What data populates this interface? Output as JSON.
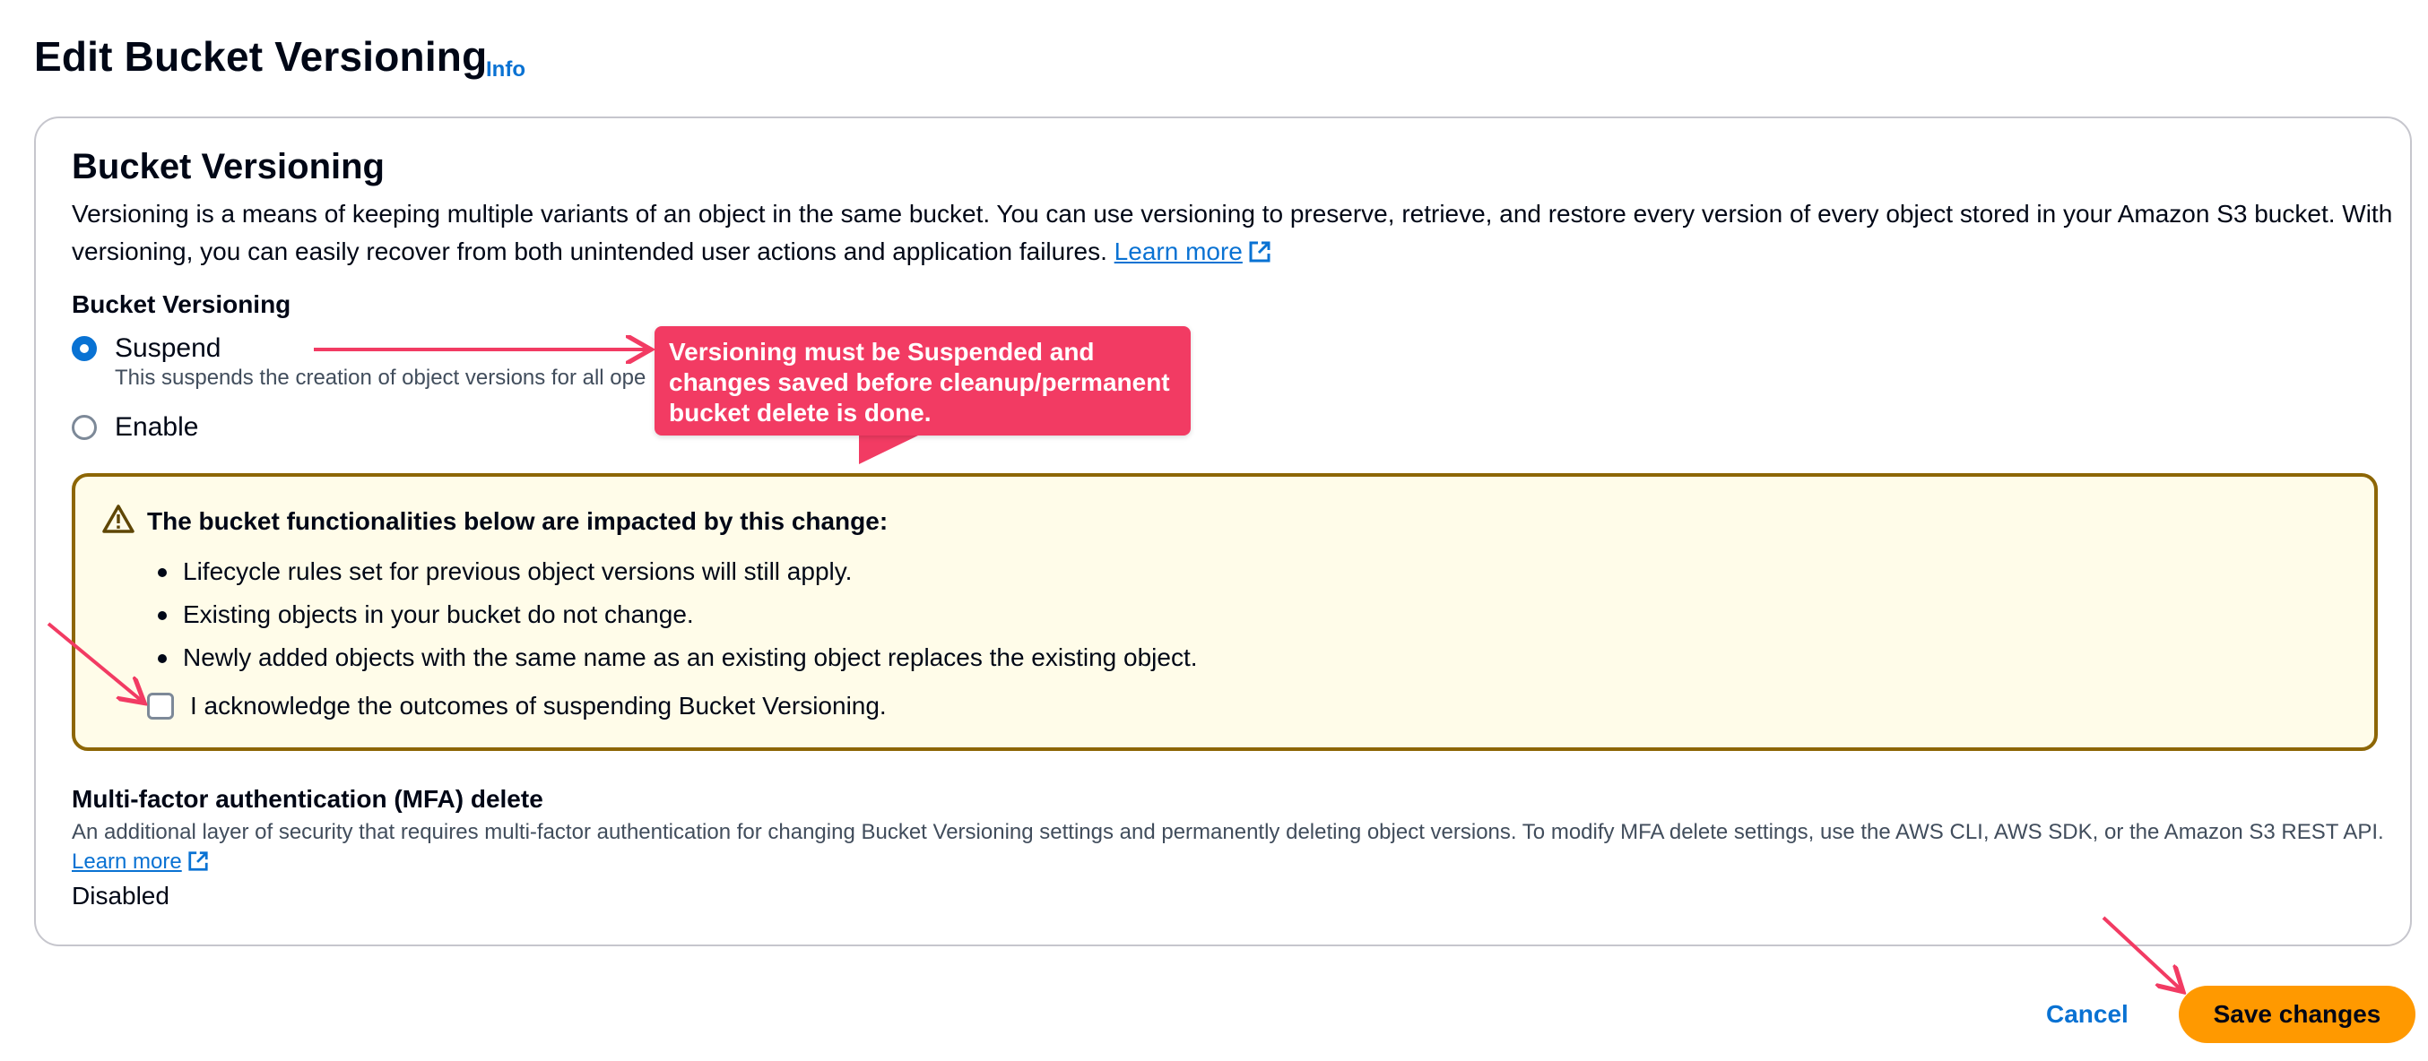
{
  "header": {
    "title": "Edit Bucket Versioning",
    "info_link": "Info"
  },
  "versioning_section": {
    "title": "Bucket Versioning",
    "description": "Versioning is a means of keeping multiple variants of an object in the same bucket. You can use versioning to preserve, retrieve, and restore every version of every object stored in your Amazon S3 bucket. With versioning, you can easily recover from both unintended user actions and application failures.",
    "learn_more": "Learn more",
    "field_label": "Bucket Versioning",
    "options": [
      {
        "label": "Suspend",
        "selected": true,
        "description": "This suspends the creation of object versions for all ope"
      },
      {
        "label": "Enable",
        "selected": false
      }
    ]
  },
  "annotation": {
    "callout_text": "Versioning must be Suspended  and changes saved before cleanup/permanent bucket delete is done.",
    "color": "#f23b63"
  },
  "warning": {
    "title": "The bucket functionalities below are impacted by this change:",
    "items": [
      "Lifecycle rules set for previous object versions will still apply.",
      "Existing objects in your bucket do not change.",
      "Newly added objects with the same name as an existing object replaces the existing object."
    ],
    "acknowledge_label": "I acknowledge the outcomes of suspending Bucket Versioning.",
    "acknowledge_checked": false,
    "icon": "warning-icon",
    "border_color": "#8d6605",
    "background": "#fffce9"
  },
  "mfa": {
    "title": "Multi-factor authentication (MFA) delete",
    "description": "An additional layer of security that requires multi-factor authentication for changing Bucket Versioning settings and permanently deleting object versions. To modify MFA delete settings, use the AWS CLI, AWS SDK, or the Amazon S3 REST API.",
    "learn_more": "Learn more",
    "value": "Disabled"
  },
  "footer": {
    "cancel_label": "Cancel",
    "save_label": "Save changes",
    "primary_color": "#ff9900",
    "link_color": "#0972d3"
  }
}
